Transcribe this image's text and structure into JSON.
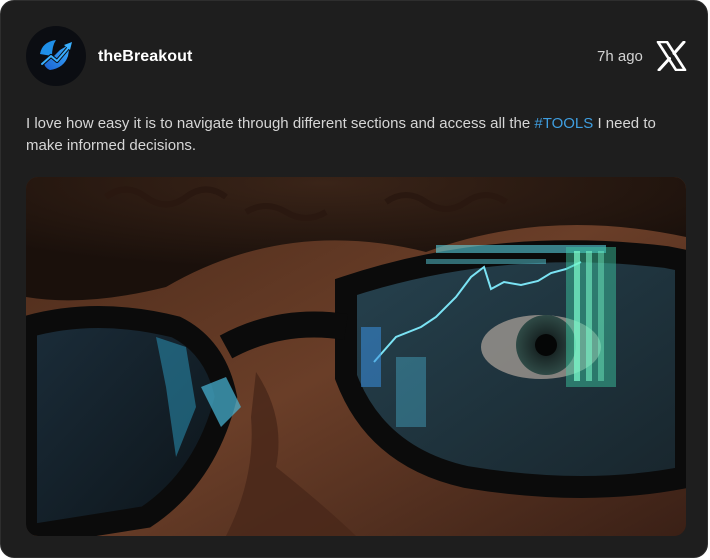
{
  "post": {
    "author": "theBreakout",
    "timestamp": "7h ago",
    "text_before": "I love how easy it is to navigate through different sections and access all the ",
    "hashtag": "#TOOLS",
    "text_after": " I need to make informed decisions."
  },
  "icons": {
    "avatar": "trending-chart-logo",
    "platform": "x-logo"
  },
  "colors": {
    "card_background": "#1e1e1e",
    "hashtag": "#3f9ee0",
    "avatar_accent": "#1f8fe8"
  }
}
